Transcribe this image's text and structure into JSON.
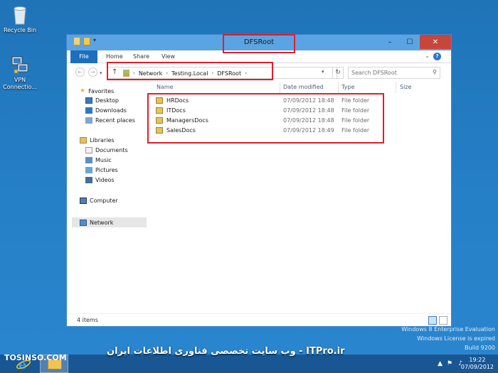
{
  "desktop": {
    "icons": [
      {
        "label": "Recycle Bin",
        "icon": "recycle-bin-icon"
      },
      {
        "label": "VPN Connectio...",
        "icon": "vpn-connection-icon"
      }
    ]
  },
  "window": {
    "title": "DFSRoot",
    "controls": {
      "minimize": "–",
      "maximize": "☐",
      "close": "✕"
    },
    "ribbon_tabs": [
      "File",
      "Home",
      "Share",
      "View"
    ],
    "help": "?",
    "breadcrumb": [
      "Network",
      "Testing.Local",
      "DFSRoot"
    ],
    "search_placeholder": "Search DFSRoot",
    "columns": [
      "Name",
      "Date modified",
      "Type",
      "Size"
    ],
    "files": [
      {
        "name": "HRDocs",
        "date": "07/09/2012 18:48",
        "type": "File folder"
      },
      {
        "name": "ITDocs",
        "date": "07/09/2012 18:48",
        "type": "File folder"
      },
      {
        "name": "ManagersDocs",
        "date": "07/09/2012 18:48",
        "type": "File folder"
      },
      {
        "name": "SalesDocs",
        "date": "07/09/2012 18:49",
        "type": "File folder"
      }
    ],
    "nav": {
      "favorites": "Favorites",
      "desktop": "Desktop",
      "downloads": "Downloads",
      "recent": "Recent places",
      "libraries": "Libraries",
      "documents": "Documents",
      "music": "Music",
      "pictures": "Pictures",
      "videos": "Videos",
      "computer": "Computer",
      "network": "Network"
    },
    "status": "4 items"
  },
  "watermark": {
    "line1": "Windows 8 Enterprise Evaluation",
    "line2": "Windows License is expired",
    "line3": "Build 9200"
  },
  "banner": {
    "fa": "ITPro.ir - وب سایت تخصصی فناوری اطلاعات ایران",
    "site": "TOSINSO.COM"
  },
  "taskbar": {
    "time": "19:22",
    "date": "07/09/2012"
  },
  "colors": {
    "desktop": "#2680c8",
    "highlight": "#e01e2b",
    "close": "#c7463b",
    "file_tab": "#1d6fbd"
  }
}
